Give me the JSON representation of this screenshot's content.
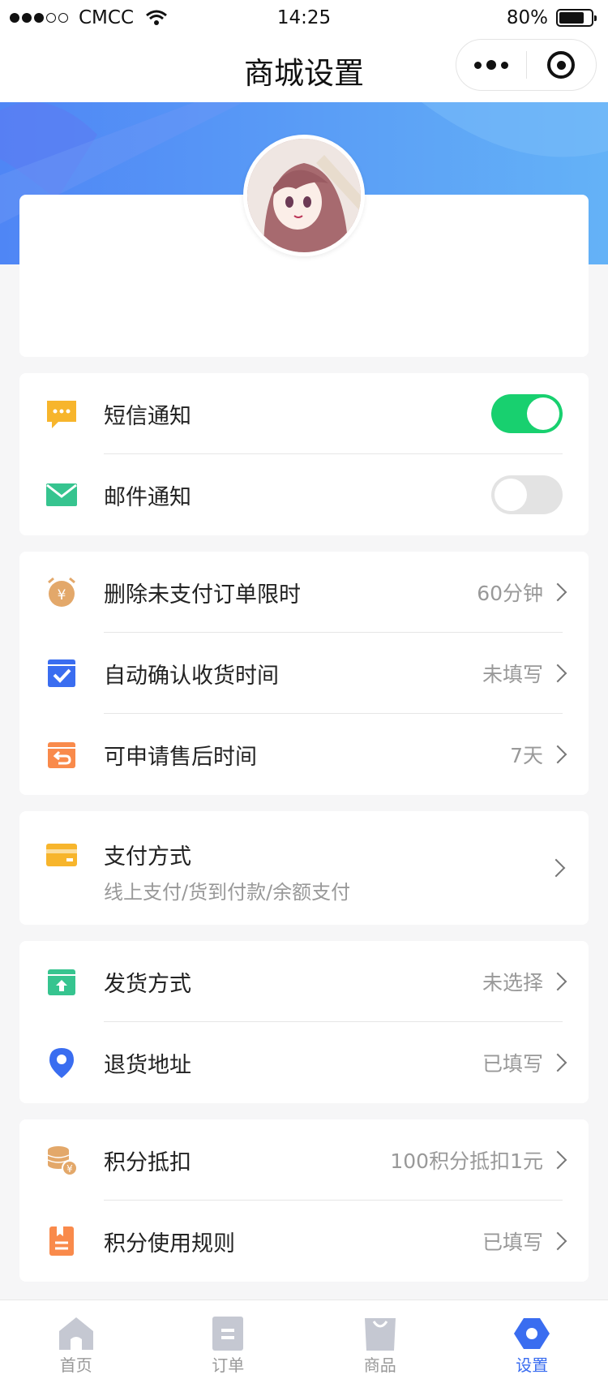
{
  "status_bar": {
    "carrier": "CMCC",
    "time": "14:25",
    "battery": "80%",
    "battery_level": 0.8
  },
  "nav": {
    "title": "商城设置"
  },
  "notifications": [
    {
      "label": "短信通知",
      "icon": "sms-icon",
      "enabled": true
    },
    {
      "label": "邮件通知",
      "icon": "mail-icon",
      "enabled": false
    }
  ],
  "orders": [
    {
      "label": "删除未支付订单限时",
      "value": "60分钟",
      "icon": "alarm-clock-icon"
    },
    {
      "label": "自动确认收货时间",
      "value": "未填写",
      "icon": "checkbox-icon"
    },
    {
      "label": "可申请售后时间",
      "value": "7天",
      "icon": "return-box-icon"
    }
  ],
  "payment": {
    "label": "支付方式",
    "sub": "线上支付/货到付款/余额支付",
    "icon": "wallet-icon"
  },
  "shipping": [
    {
      "label": "发货方式",
      "value": "未选择",
      "icon": "ship-box-icon"
    },
    {
      "label": "退货地址",
      "value": "已填写",
      "icon": "location-pin-icon"
    }
  ],
  "points": [
    {
      "label": "积分抵扣",
      "value": "100积分抵扣1元",
      "icon": "coins-icon"
    },
    {
      "label": "积分使用规则",
      "value": "已填写",
      "icon": "rule-book-icon"
    }
  ],
  "tabs": [
    {
      "label": "首页",
      "icon": "home-icon",
      "active": false
    },
    {
      "label": "订单",
      "icon": "order-icon",
      "active": false
    },
    {
      "label": "商品",
      "icon": "bag-icon",
      "active": false
    },
    {
      "label": "设置",
      "icon": "settings-icon",
      "active": true
    }
  ],
  "colors": {
    "accent": "#3a6df0",
    "toggle_on": "#18d06f",
    "sms": "#f7b52c",
    "mail": "#36c48f",
    "alarm": "#e3a86a",
    "check": "#3a6df0",
    "return": "#f98a4b",
    "wallet": "#f7b52c",
    "ship": "#36c48f",
    "pin": "#3a6df0",
    "coins": "#e3a86a",
    "book": "#f98a4b"
  }
}
